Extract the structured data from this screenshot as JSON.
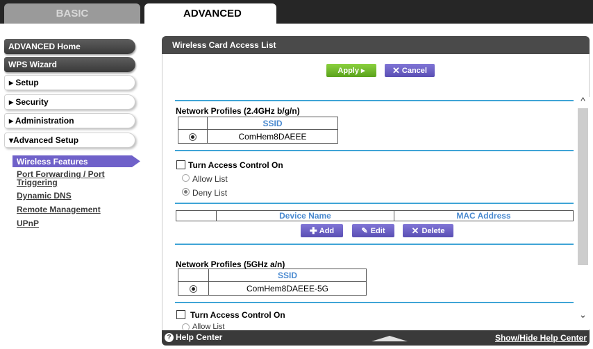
{
  "tabs": {
    "basic": "BASIC",
    "advanced": "ADVANCED"
  },
  "sidebar": {
    "home": "ADVANCED Home",
    "wps": "WPS Wizard",
    "setup": "▸ Setup",
    "security": "▸ Security",
    "administration": "▸ Administration",
    "advanced_setup": "▾Advanced Setup",
    "subitems": {
      "wireless_features": "Wireless Features",
      "port_forwarding_1": "Port Forwarding / Port",
      "port_forwarding_2": "Triggering",
      "dynamic_dns": "Dynamic DNS",
      "remote_management": "Remote Management",
      "upnp": "UPnP"
    }
  },
  "panel": {
    "title": "Wireless Card Access List",
    "apply": "Apply ▸",
    "cancel": "Cancel"
  },
  "profile24": {
    "title": "Network Profiles (2.4GHz b/g/n)",
    "ssid_header": "SSID",
    "ssid_value": "ComHem8DAEEE"
  },
  "access24": {
    "turn_on": "Turn Access Control On",
    "allow": "Allow List",
    "deny": "Deny List"
  },
  "device_table": {
    "device_name": "Device Name",
    "mac_address": "MAC Address"
  },
  "buttons": {
    "add": "Add",
    "edit": "Edit",
    "delete": "Delete"
  },
  "profile5": {
    "title": "Network Profiles (5GHz a/n)",
    "ssid_header": "SSID",
    "ssid_value": "ComHem8DAEEE-5G"
  },
  "access5": {
    "turn_on": "Turn Access Control On",
    "allow": "Allow List"
  },
  "footer": {
    "help_center": "Help Center",
    "show_hide": "Show/Hide Help Center"
  }
}
